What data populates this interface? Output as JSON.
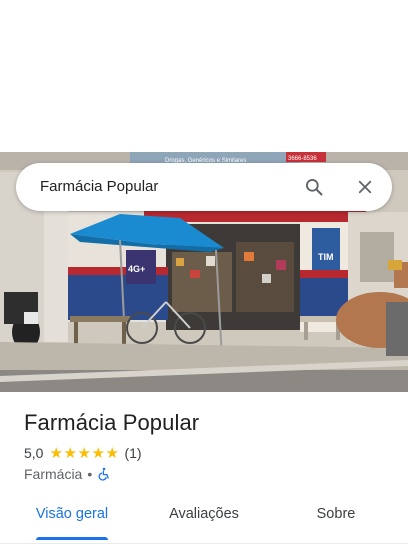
{
  "search": {
    "query": "Farmácia Popular",
    "search_icon": "search-icon",
    "close_icon": "close-icon"
  },
  "photo": {
    "description_icon": "street-view-photo",
    "storefront_sign_text": "Drogas, Genéricos e Similares",
    "phone_text": "3666-8536",
    "banner_4g": "4G+",
    "banner_tim": "TIM"
  },
  "place": {
    "name": "Farmácia Popular",
    "rating": "5,0",
    "stars": [
      "★",
      "★",
      "★",
      "★",
      "★"
    ],
    "review_count": "(1)",
    "category": "Farmácia",
    "separator": "•",
    "accessibility_icon": "wheelchair-icon"
  },
  "tabs": [
    {
      "label": "Visão geral",
      "active": true
    },
    {
      "label": "Avaliações",
      "active": false
    },
    {
      "label": "Sobre",
      "active": false
    }
  ],
  "colors": {
    "accent": "#1a73e8",
    "star": "#fbbc04",
    "text_primary": "#202124",
    "text_secondary": "#5f6368"
  }
}
